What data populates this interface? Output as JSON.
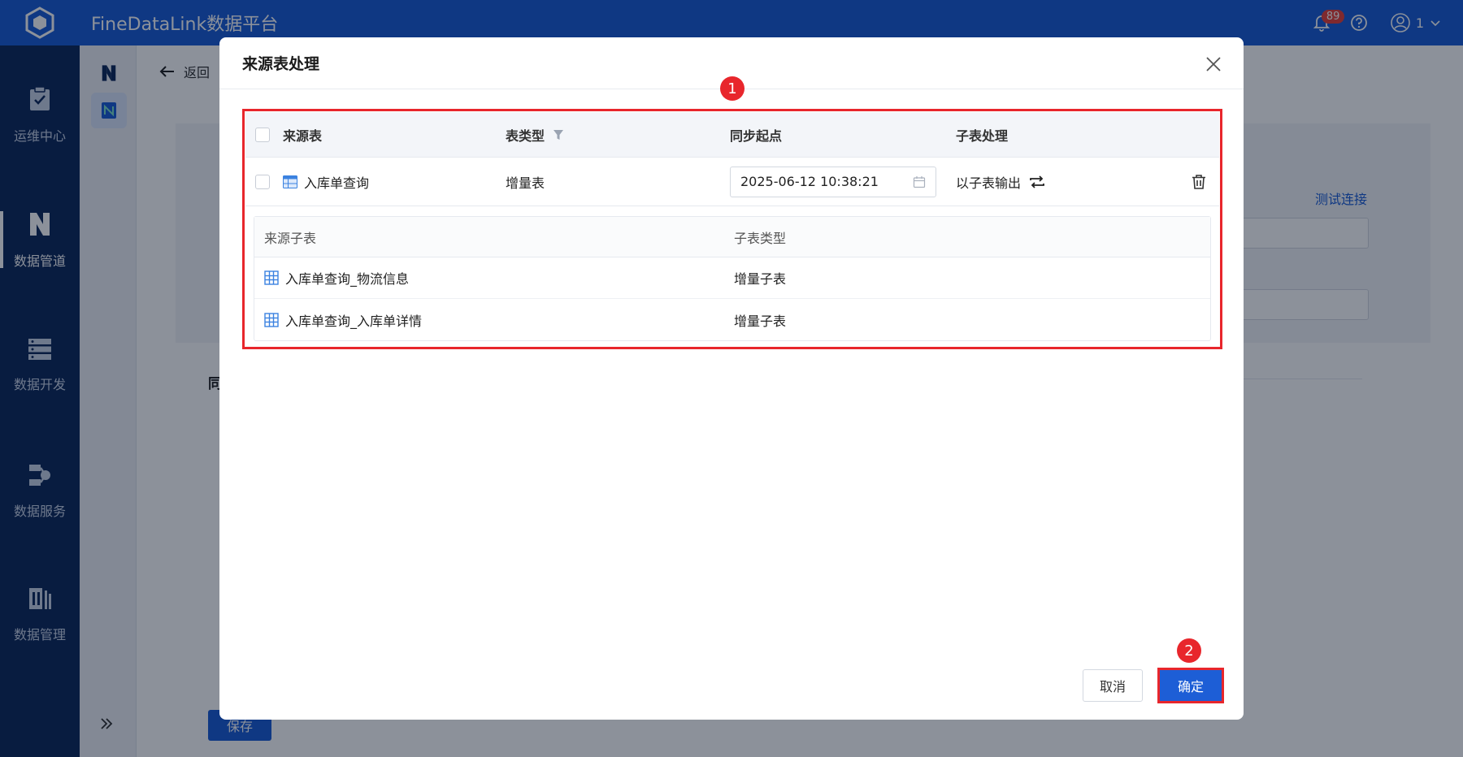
{
  "header": {
    "app_title": "FineDataLink数据平台",
    "notification_count": "89",
    "user_name": "1"
  },
  "sidebar": {
    "items": [
      {
        "label": "运维中心",
        "icon": "clipboard-check-icon"
      },
      {
        "label": "数据管道",
        "icon": "pipeline-icon",
        "active": true
      },
      {
        "label": "数据开发",
        "icon": "server-icon"
      },
      {
        "label": "数据服务",
        "icon": "api-service-icon"
      },
      {
        "label": "数据管理",
        "icon": "data-manage-icon"
      }
    ]
  },
  "background_page": {
    "back_label": "返回",
    "test_connection": "测试连接",
    "section_heading": "同",
    "save_label": "保存"
  },
  "modal": {
    "title": "来源表处理",
    "table": {
      "columns": [
        "来源表",
        "表类型",
        "同步起点",
        "子表处理"
      ],
      "rows": [
        {
          "source_table": "入库单查询",
          "table_type": "增量表",
          "sync_start": "2025-06-12 10:38:21",
          "sub_processing": "以子表输出"
        }
      ]
    },
    "subtable": {
      "columns": [
        "来源子表",
        "子表类型"
      ],
      "rows": [
        {
          "name": "入库单查询_物流信息",
          "type": "增量子表"
        },
        {
          "name": "入库单查询_入库单详情",
          "type": "增量子表"
        }
      ]
    },
    "markers": [
      "1",
      "2"
    ],
    "cancel_label": "取消",
    "confirm_label": "确定"
  },
  "colors": {
    "primary": "#1d5ed6",
    "sidebar": "#102a5c",
    "highlight": "#e8262c"
  }
}
